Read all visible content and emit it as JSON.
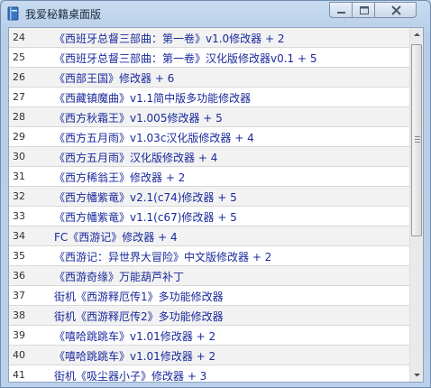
{
  "window": {
    "title": "我爱秘籍桌面版"
  },
  "list": {
    "rows": [
      {
        "num": "24",
        "text": "《西班牙总督三部曲：第一卷》v1.0修改器 + 2"
      },
      {
        "num": "25",
        "text": "《西班牙总督三部曲：第一卷》汉化版修改器v0.1 + 5"
      },
      {
        "num": "26",
        "text": "《西部王国》修改器 + 6"
      },
      {
        "num": "27",
        "text": "《西藏镇魔曲》v1.1简中版多功能修改器"
      },
      {
        "num": "28",
        "text": "《西方秋霜王》v1.005修改器 + 5"
      },
      {
        "num": "29",
        "text": "《西方五月雨》v1.03c汉化版修改器 + 4"
      },
      {
        "num": "30",
        "text": "《西方五月雨》汉化版修改器 + 4"
      },
      {
        "num": "31",
        "text": "《西方稀翁王》修改器 + 2"
      },
      {
        "num": "32",
        "text": "《西方幡紫竜》v2.1(c74)修改器 + 5"
      },
      {
        "num": "33",
        "text": "《西方幡紫竜》v1.1(c67)修改器 + 5"
      },
      {
        "num": "34",
        "text": "FC《西游记》修改器 + 4"
      },
      {
        "num": "35",
        "text": "《西游记：异世界大冒险》中文版修改器 + 2"
      },
      {
        "num": "36",
        "text": "《西游奇缘》万能葫芦补丁"
      },
      {
        "num": "37",
        "text": "街机《西游释厄传1》多功能修改器"
      },
      {
        "num": "38",
        "text": "街机《西游释厄传2》多功能修改器"
      },
      {
        "num": "39",
        "text": "《嘻哈跳跳车》v1.01修改器 + 2"
      },
      {
        "num": "40",
        "text": "《嘻哈跳跳车》v1.01修改器 + 2"
      },
      {
        "num": "41",
        "text": "街机《吸尘器小子》修改器 + 3"
      }
    ]
  },
  "icons": {
    "app": "book-icon",
    "minimize": "minimize-icon",
    "maximize": "maximize-icon",
    "close": "close-icon",
    "scroll_up": "scroll-up-arrow-icon",
    "scroll_down": "scroll-down-arrow-icon"
  },
  "colors": {
    "link_text": "#1a2a9c",
    "row_alt": "#f2f2f2",
    "frame": "#b9d1ea"
  }
}
